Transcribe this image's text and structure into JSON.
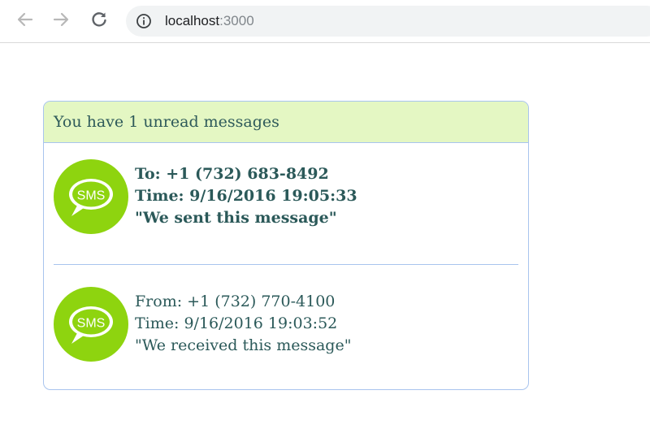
{
  "browser": {
    "url_host": "localhost",
    "url_port": ":3000"
  },
  "panel": {
    "heading": "You have 1 unread messages",
    "heading_color": "#e4f7c3",
    "border_color": "#a8c4ee"
  },
  "messages": [
    {
      "icon_label": "SMS",
      "party": "To: +1 (732) 683-8492",
      "time": "Time: 9/16/2016 19:05:33",
      "body": "\"We sent this message\"",
      "unread": true
    },
    {
      "icon_label": "SMS",
      "party": "From: +1 (732) 770-4100",
      "time": "Time: 9/16/2016 19:03:52",
      "body": "\"We received this message\"",
      "unread": false
    }
  ],
  "colors": {
    "sms_green": "#8ed40f",
    "text": "#2b5959"
  },
  "icons": {
    "back": "arrow-left-icon",
    "forward": "arrow-right-icon",
    "reload": "reload-icon",
    "info": "info-icon",
    "sms": "sms-bubble-icon"
  }
}
